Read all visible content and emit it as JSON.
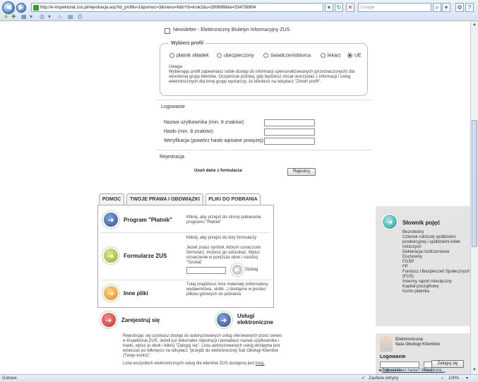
{
  "browser": {
    "url": "http://e-inspektorat.zus.pl/rejestracja.asp?id_profilu=1&pomoc=3&menu=6&trYb=krok2&u=2906668&e=334756904",
    "search_placeholder": "Google",
    "status_left": "Gotowe",
    "status_trusted": "Zaufane witryny",
    "status_zoom": "100%"
  },
  "newsletter": {
    "label": "Newsletter - Elektroniczny Biuletyn Informacyjny ZUS"
  },
  "profile": {
    "legend": "Wybierz profil",
    "options": [
      "płatnik składek",
      "ubezpieczony",
      "świadczeniobiorca",
      "lekarz",
      "UE"
    ],
    "selected": "UE",
    "note_title": "Uwaga:",
    "note_text": "Wybierając profil zapewniasz sobie dostęp do informacji spersonalizowanych (przeznaczonych) dla określonej grupy klientów. Oczywiście później, gdy będziesz chciał skorzystać z informacji i usług elektronicznych dla innej grupy wystarczy, że klikniesz na odsyłacz \"Zmień profil\"."
  },
  "login": {
    "heading": "Logowanie",
    "username_label": "Nazwa użytkownika (min. 8 znaków):",
    "password_label": "Hasło (min. 8 znaków):",
    "verify_label": "Weryfikacja (powtórz hasło wpisane powyżej):"
  },
  "registration": {
    "heading": "Rejestracja",
    "clear_label": "Usuń dane z formularza",
    "submit_label": "Rejestruj"
  },
  "tabs": [
    "POMOC",
    "TWOJE PRAWA I OBOWIĄZKI",
    "PLIKI DO POBRANIA"
  ],
  "downloads": {
    "platnik_title": "Program \"Płatnik\"",
    "platnik_desc": "Kliknij, aby przejść do strony pobierania programu \"Płatnik\"",
    "forms_title": "Formularze ZUS",
    "forms_desc1": "Kliknij, aby przejść do listy formularzy",
    "forms_desc2": "Jeżeli znasz symbol, którym oznaczono formularz, możesz go odszukać. Wpisz oznaczenie w poniższe okno i naciśnij \"Szukaj\"",
    "search_label": "Szukaj",
    "other_title": "Inne pliki",
    "other_desc": "Tutaj znajdziesz inne materiały (informatory, wydawnictwa, ulotki...) dostępne w postaci plików gotowych do pobrania"
  },
  "glossary": {
    "title": "Słownik pojęć",
    "items": [
      "Bezrobotny",
      "Członek rolniczej spółdzielni produkcyjnej i spółdzielni kółek rolniczych",
      "Deklaracja rozliczeniowa",
      "Duchowny",
      "FGŚP",
      "FP",
      "Fundusz Ubezpieczeń Społecznych (FUS)",
      "Imienny raport miesięczny",
      "Kapitał początkowy",
      "Konto płatnika"
    ]
  },
  "bottom": {
    "register_title": "Zarejestruj się",
    "services_title": "Usługi elektroniczne",
    "register_text": "Rejestrując się uzyskasz dostęp do autoryzowanych usług oferowanych przez serwis e-Inspektorat ZUS. Jeżeli już dokonałeś rejestracji i posiadasz nazwę użytkownika i hasło, wpisz je obok i kliknij \"Zaloguj się\". Lista autoryzowanych usług dostępna jest wówczas po kliknięciu na odsyłacz \"przejdź do elektronicznej Sali Obsługi Klientów (Twoje konto)\".",
    "list_text": "Lista wszystkich elektronicznych usług dla klientów ZUS dostępna jest",
    "list_link": "tutaj."
  },
  "client": {
    "title_line1": "Elektroniczna",
    "title_line2": "Sala Obsługi Klientów",
    "login_heading": "Logowanie",
    "user_label": "użytkownik",
    "pass_label": "hasło",
    "login_button": "Zaloguj się",
    "forgot_link": "Zapomniałeś hasła? Kliknij tutaj..."
  }
}
